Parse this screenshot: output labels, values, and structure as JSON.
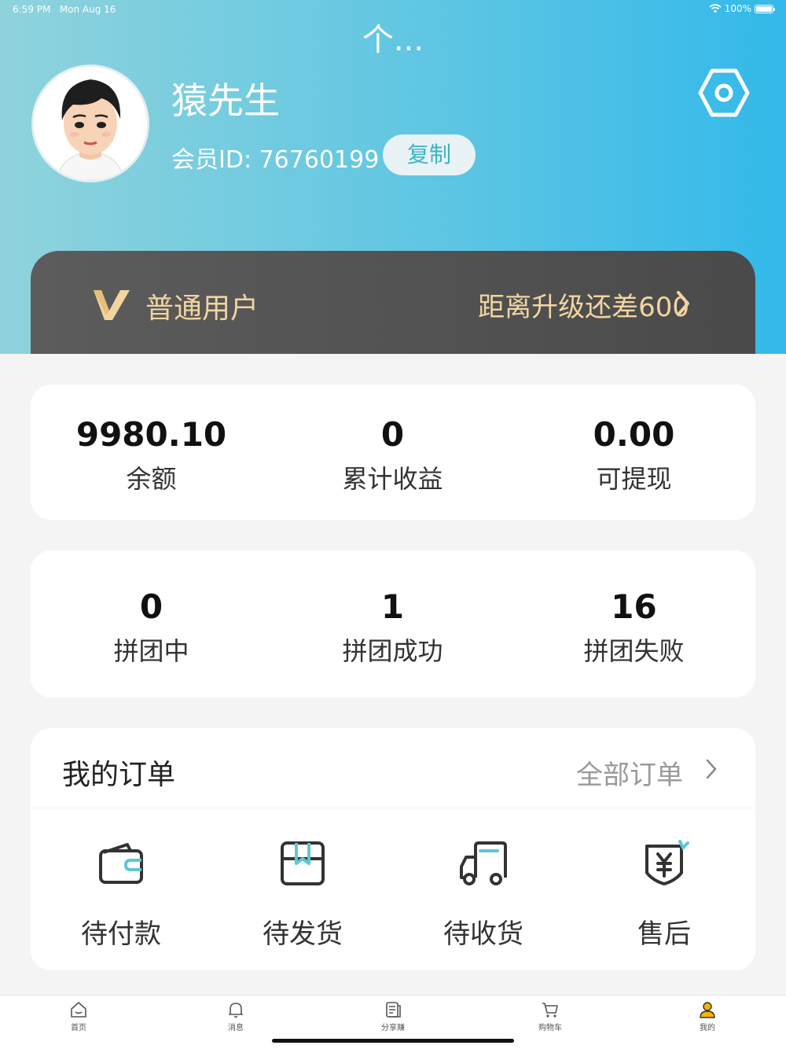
{
  "status_bar": {
    "time": "6:59 PM",
    "date": "Mon Aug 16",
    "battery": "100%",
    "battery_level": 1.0
  },
  "nav": {
    "title": "个..."
  },
  "profile": {
    "name": "猿先生",
    "member_id": "会员ID: 76760199",
    "copy_label": "复制"
  },
  "vip": {
    "level": "普通用户",
    "upgrade_text": "距离升级还差600",
    "accent_color": "#f2d5a0"
  },
  "stats": [
    {
      "value": "9980.10",
      "label": "余额"
    },
    {
      "value": "0",
      "label": "累计收益"
    },
    {
      "value": "0.00",
      "label": "可提现"
    }
  ],
  "group_buy": [
    {
      "value": "0",
      "label": "拼团中"
    },
    {
      "value": "1",
      "label": "拼团成功"
    },
    {
      "value": "16",
      "label": "拼团失败"
    }
  ],
  "orders": {
    "title": "我的订单",
    "all_label": "全部订单",
    "items": [
      {
        "label": "待付款",
        "icon": "wallet-icon"
      },
      {
        "label": "待发货",
        "icon": "package-icon"
      },
      {
        "label": "待收货",
        "icon": "truck-icon"
      },
      {
        "label": "售后",
        "icon": "yuan-shield-icon"
      }
    ]
  },
  "tabs": [
    {
      "label": "首页",
      "icon": "home-icon",
      "active": false
    },
    {
      "label": "消息",
      "icon": "bell-icon",
      "active": false
    },
    {
      "label": "分享赚",
      "icon": "document-icon",
      "active": false
    },
    {
      "label": "购物车",
      "icon": "cart-icon",
      "active": false
    },
    {
      "label": "我的",
      "icon": "user-icon",
      "active": true
    }
  ],
  "colors": {
    "header_start": "#8fd3dc",
    "header_end": "#33b9ea",
    "icon_accent": "#5cc7d5",
    "active_tab": "#f5b400"
  }
}
